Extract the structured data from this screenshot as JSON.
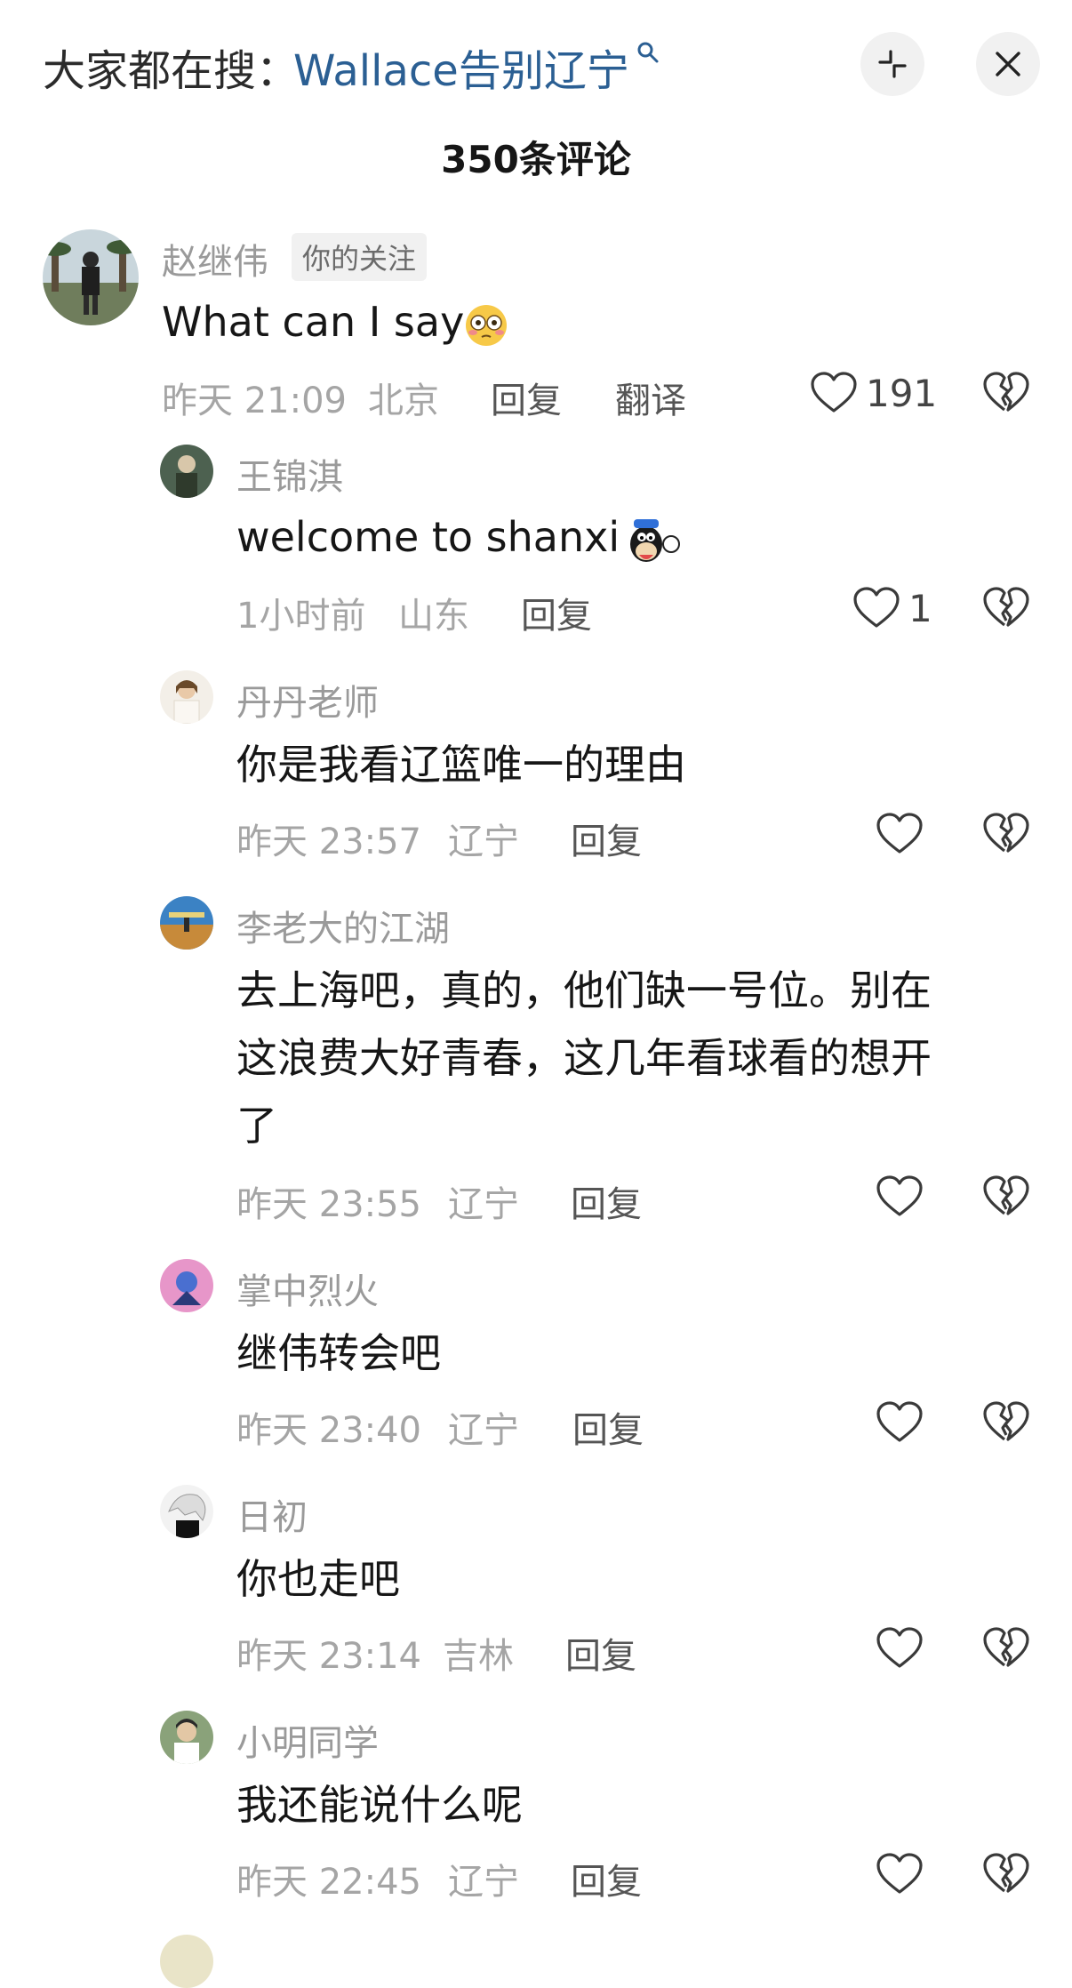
{
  "header": {
    "search_prefix": "大家都在搜：",
    "search_term": "Wallace告别辽宁",
    "comment_count": "350条评论"
  },
  "comments": [
    {
      "name": "赵继伟",
      "tag": "你的关注",
      "text": "What can I say",
      "time": "昨天 21:09",
      "location": "北京",
      "reply": "回复",
      "translate": "翻译",
      "likes": "191"
    },
    {
      "name": "王锦淇",
      "text": "welcome to shanxi",
      "time": "1小时前",
      "location": "山东",
      "reply": "回复",
      "likes": "1"
    },
    {
      "name": "丹丹老师",
      "text": "你是我看辽篮唯一的理由",
      "time": "昨天 23:57",
      "location": "辽宁",
      "reply": "回复"
    },
    {
      "name": "李老大的江湖",
      "text_lines": [
        "去上海吧，真的，他们缺一号位。别在",
        "这浪费大好青春，这几年看球看的想开",
        "了"
      ],
      "time": "昨天 23:55",
      "location": "辽宁",
      "reply": "回复"
    },
    {
      "name": "掌中烈火",
      "text": "继伟转会吧",
      "time": "昨天 23:40",
      "location": "辽宁",
      "reply": "回复"
    },
    {
      "name": "日初",
      "text": "你也走吧",
      "time": "昨天 23:14",
      "location": "吉林",
      "reply": "回复"
    },
    {
      "name": "小明同学",
      "text": "我还能说什么呢",
      "time": "昨天 22:45",
      "location": "辽宁",
      "reply": "回复"
    }
  ],
  "icons": {
    "like": "heart-outline-icon",
    "dislike": "broken-heart-icon",
    "search": "search-icon",
    "collapse": "collapse-icon",
    "close": "close-icon"
  }
}
